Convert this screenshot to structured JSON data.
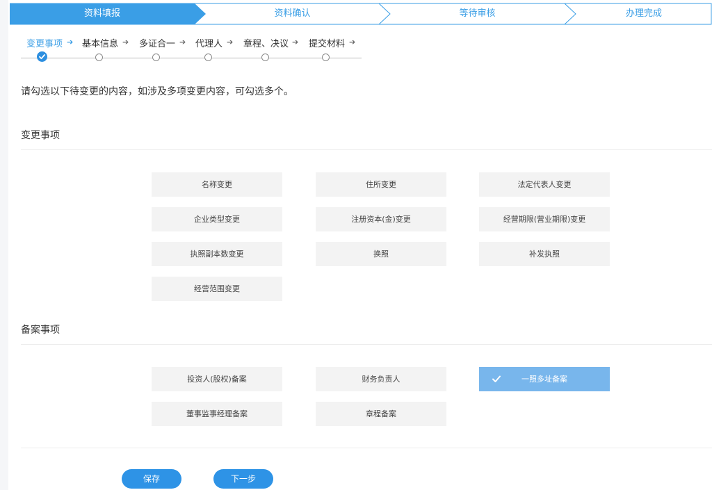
{
  "wizard": {
    "steps": [
      "资料填报",
      "资料确认",
      "等待审核",
      "办理完成"
    ],
    "active_index": 0
  },
  "substeps": {
    "items": [
      "变更事项",
      "基本信息",
      "多证合一",
      "代理人",
      "章程、决议",
      "提交材料"
    ],
    "active_index": 0
  },
  "instruction": "请勾选以下待变更的内容，如涉及多项变更内容，可勾选多个。",
  "change_section": {
    "title": "变更事项",
    "options": [
      "名称变更",
      "住所变更",
      "法定代表人变更",
      "企业类型变更",
      "注册资本(金)变更",
      "经营期限(营业期限)变更",
      "执照副本数变更",
      "换照",
      "补发执照",
      "经营范围变更"
    ]
  },
  "record_section": {
    "title": "备案事项",
    "options": [
      "投资人(股权)备案",
      "财务负责人",
      "一照多址备案",
      "董事监事经理备案",
      "章程备案"
    ],
    "selected_index": 2
  },
  "buttons": {
    "save": "保存",
    "next": "下一步"
  },
  "colors": {
    "primary": "#2e93e6",
    "active_step": "#3a9ee6",
    "selected_option": "#78b6ec",
    "option_bg": "#f3f3f3"
  }
}
